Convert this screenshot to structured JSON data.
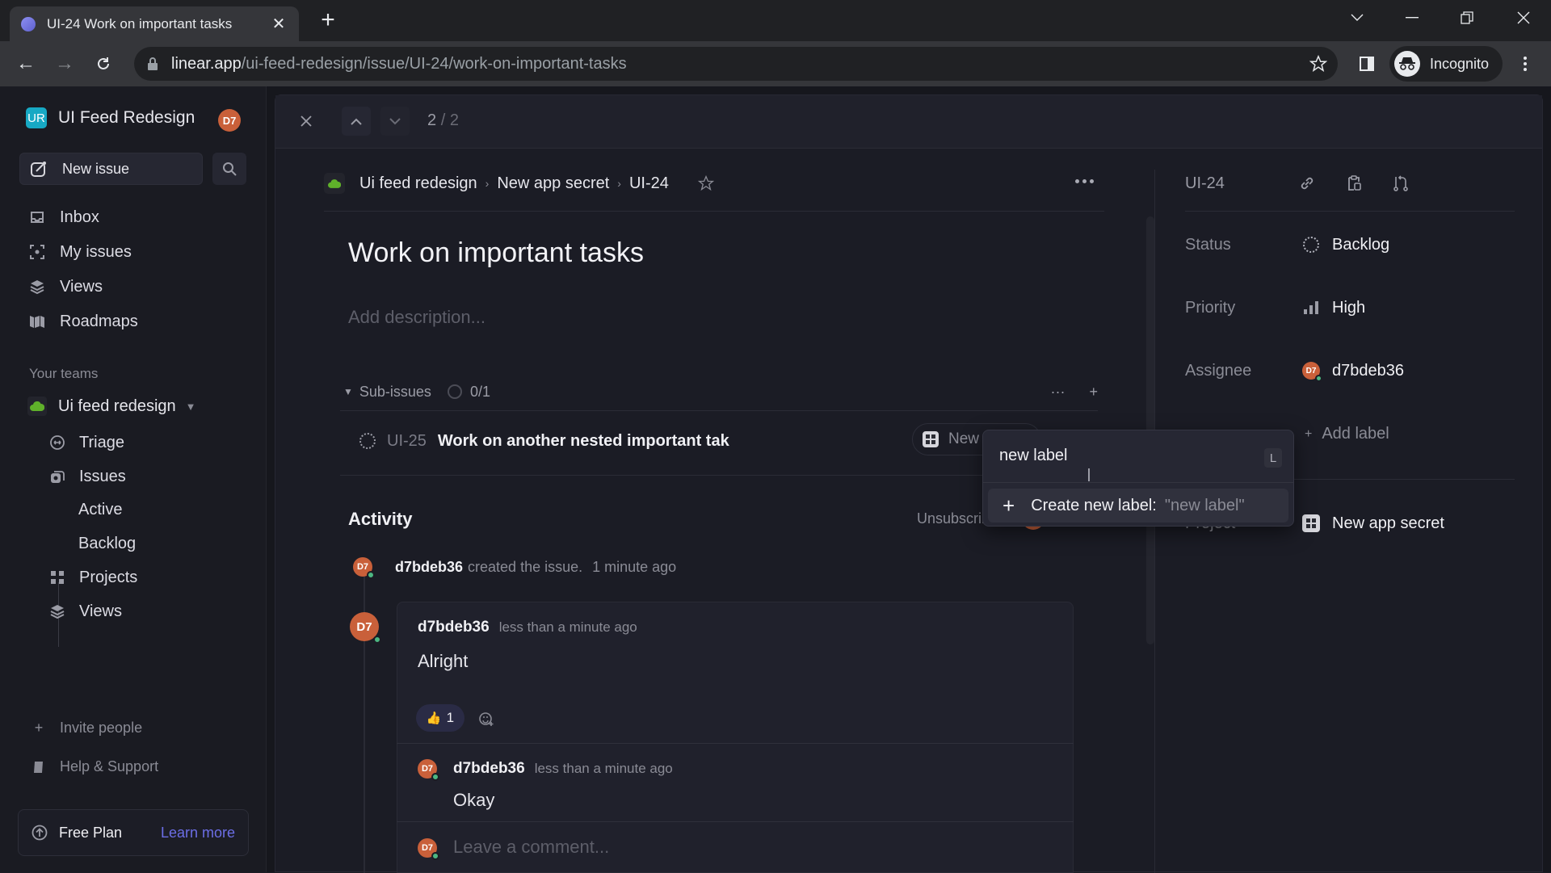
{
  "browser": {
    "tab_title": "UI-24 Work on important tasks",
    "url_host": "linear.app",
    "url_path": "/ui-feed-redesign/issue/UI-24/work-on-important-tasks",
    "profile_label": "Incognito"
  },
  "sidebar": {
    "workspace_logo": "UR",
    "workspace_name": "UI Feed Redesign",
    "user_initials": "D7",
    "new_issue_label": "New issue",
    "nav": [
      {
        "label": "Inbox",
        "icon": "inbox-icon"
      },
      {
        "label": "My issues",
        "icon": "my-issues-icon"
      },
      {
        "label": "Views",
        "icon": "views-icon"
      },
      {
        "label": "Roadmaps",
        "icon": "roadmap-icon"
      }
    ],
    "teams_section_label": "Your teams",
    "team": {
      "name": "Ui feed redesign",
      "items": [
        {
          "label": "Triage",
          "icon": "triage-icon"
        },
        {
          "label": "Issues",
          "icon": "issues-icon"
        },
        {
          "label": "Projects",
          "icon": "projects-icon"
        },
        {
          "label": "Views",
          "icon": "views-icon"
        }
      ],
      "issue_children": [
        "Active",
        "Backlog"
      ]
    },
    "invite_label": "Invite people",
    "help_label": "Help & Support",
    "plan_label": "Free Plan",
    "plan_link": "Learn more"
  },
  "modal": {
    "counter_current": "2",
    "counter_total": "2",
    "breadcrumb": [
      "Ui feed redesign",
      "New app secret",
      "UI-24"
    ],
    "title": "Work on important tasks",
    "description_placeholder": "Add description...",
    "sub_issues": {
      "label": "Sub-issues",
      "progress": "0/1",
      "items": [
        {
          "id": "UI-25",
          "title": "Work on another nested important tak",
          "project_chip": "New"
        }
      ]
    },
    "activity": {
      "heading": "Activity",
      "unsubscribe_label": "Unsubscribe",
      "created": {
        "user": "d7bdeb36",
        "text": "created the issue.",
        "time": "1 minute ago"
      },
      "comments": [
        {
          "user": "d7bdeb36",
          "time": "less than a minute ago",
          "body": "Alright",
          "reaction_emoji": "👍",
          "reaction_count": "1"
        },
        {
          "user": "d7bdeb36",
          "time": "less than a minute ago",
          "body": "Okay"
        }
      ],
      "reply_placeholder": "Leave a comment..."
    }
  },
  "details": {
    "issue_id": "UI-24",
    "status_label": "Status",
    "status_value": "Backlog",
    "priority_label": "Priority",
    "priority_value": "High",
    "assignee_label": "Assignee",
    "assignee_value": "d7bdeb36",
    "add_label": "Add label",
    "project_label": "Project",
    "project_value": "New app secret"
  },
  "label_popover": {
    "input_value": "new label",
    "shortcut": "L",
    "create_text": "Create new label:",
    "create_value": "\"new label\""
  },
  "colors": {
    "accent": "#6c6ee6",
    "avatar": "#c9603a",
    "online": "#4cb782",
    "team_green": "#5fb02a",
    "workspace_logo": "#17a9c4"
  }
}
